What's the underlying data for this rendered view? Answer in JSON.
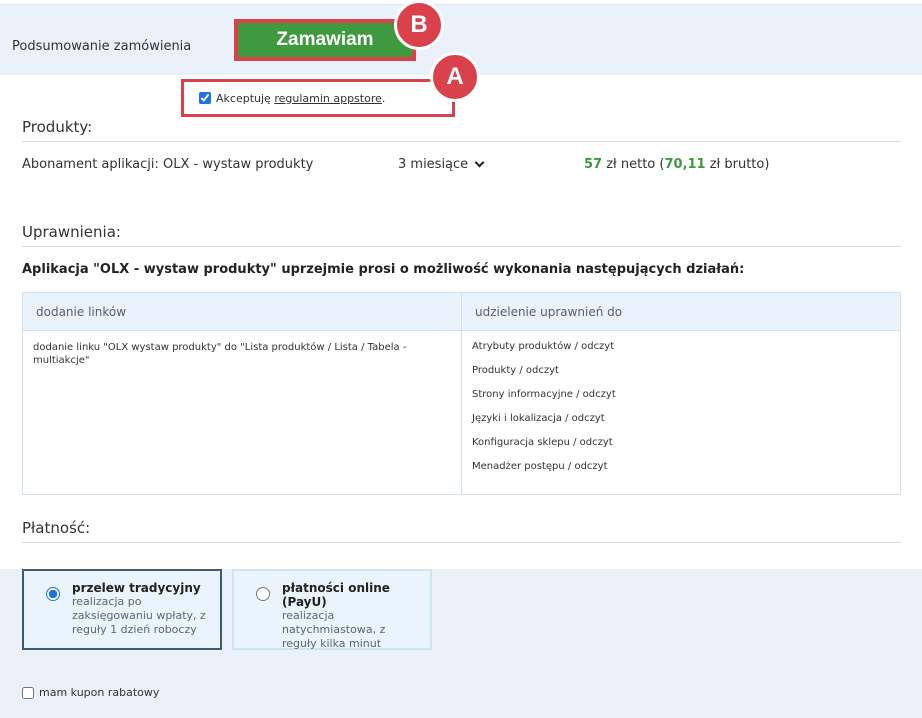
{
  "header": {
    "title": "Podsumowanie zamówienia",
    "order_button": "Zamawiam"
  },
  "annotations": {
    "a": "A",
    "b": "B"
  },
  "terms": {
    "checked": true,
    "prefix": "Akceptuję",
    "link": "regulamin appstore",
    "suffix": "."
  },
  "products": {
    "heading": "Produkty:",
    "item_name": "Abonament aplikacji: OLX - wystaw produkty",
    "period": "3 miesiące",
    "price_net": "57",
    "price_net_suffix": " zł netto (",
    "price_gross": "70,11",
    "price_gross_suffix": " zł brutto)"
  },
  "permissions": {
    "heading": "Uprawnienia:",
    "request": "Aplikacja \"OLX - wystaw produkty\" uprzejmie prosi o możliwość wykonania następujących działań:",
    "columns": [
      "dodanie linków",
      "udzielenie uprawnień do"
    ],
    "links_cell": "dodanie linku \"OLX wystaw produkty\" do \"Lista produktów / Lista / Tabela - multiakcje\"",
    "grants": [
      "Atrybuty produktów / odczyt",
      "Produkty / odczyt",
      "Strony informacyjne / odczyt",
      "Języki i lokalizacja / odczyt",
      "Konfiguracja sklepu / odczyt",
      "Menadżer postępu / odczyt"
    ]
  },
  "payment": {
    "heading": "Płatność:",
    "options": [
      {
        "title": "przelew tradycyjny",
        "desc": "realizacja po zaksięgowaniu wpłaty, z reguły 1 dzień roboczy",
        "selected": true
      },
      {
        "title": "płatności online (PayU)",
        "desc": "realizacja natychmiastowa, z reguły kilka minut",
        "selected": false
      }
    ]
  },
  "coupon": {
    "label": "mam kupon rabatowy",
    "checked": false
  },
  "colors": {
    "accent_green": "#3f9a3f",
    "highlight_red": "#d9414b",
    "panel_blue": "#ebf1f8"
  }
}
